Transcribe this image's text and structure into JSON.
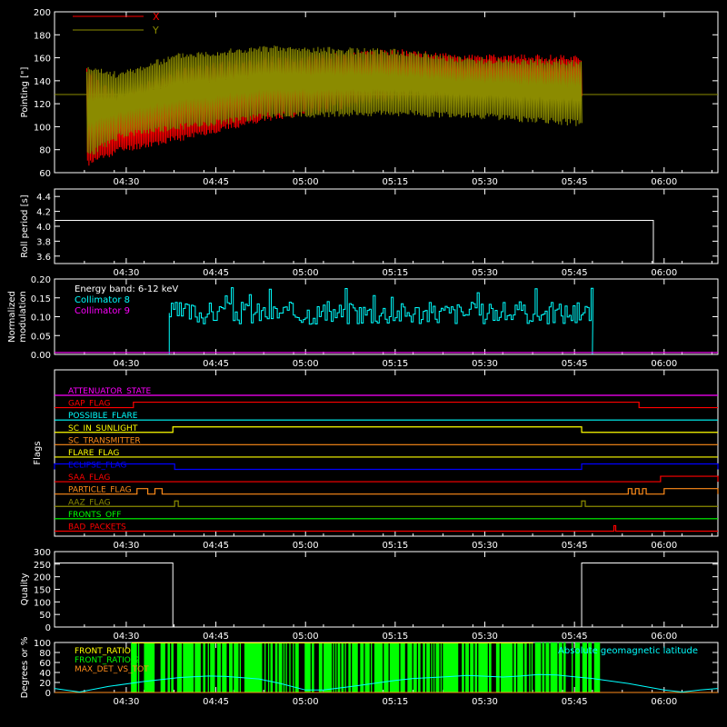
{
  "colors": {
    "background": "#000000",
    "axes": "#ffffff",
    "x_red": "#ff0000",
    "y_olive": "#8b8b00",
    "cyan": "#00ffff",
    "magenta": "#ff00ff",
    "green": "#00ff00",
    "yellow": "#ffff00",
    "orange": "#ff8c1a",
    "blue": "#0000ff"
  },
  "chart_data": [
    {
      "id": "pointing",
      "type": "line",
      "ylabel": "Pointing [\"]",
      "ylim": [
        60,
        200
      ],
      "yticks": [
        60,
        80,
        100,
        120,
        140,
        160,
        180,
        200
      ],
      "x_ticks": [
        "04:30",
        "04:45",
        "05:00",
        "05:15",
        "05:30",
        "05:45",
        "06:00"
      ],
      "xlim_min": [
        4.3,
        6.15
      ],
      "series": [
        {
          "name": "X",
          "color": "#ff0000",
          "envelope_x_min": [
            4.39,
            4.48,
            4.65,
            4.9,
            5.25,
            5.45,
            5.77
          ],
          "upper": [
            150,
            125,
            150,
            158,
            165,
            160,
            160
          ],
          "lower": [
            68,
            80,
            90,
            108,
            125,
            128,
            128
          ]
        },
        {
          "name": "Y",
          "color": "#8b8b00",
          "envelope_x_min": [
            4.39,
            4.48,
            4.65,
            4.9,
            5.25,
            5.45,
            5.77
          ],
          "upper": [
            150,
            145,
            162,
            168,
            165,
            158,
            155
          ],
          "lower": [
            75,
            92,
            100,
            110,
            112,
            110,
            103
          ]
        }
      ],
      "baseline": 128,
      "span_min": [
        4.39,
        5.77
      ],
      "legend": [
        "X",
        "Y"
      ]
    },
    {
      "id": "roll",
      "type": "line",
      "ylabel": "Roll period [s]",
      "ylim": [
        3.5,
        4.5
      ],
      "yticks": [
        3.6,
        3.8,
        4.0,
        4.2,
        4.4
      ],
      "x_ticks": [
        "04:30",
        "04:45",
        "05:00",
        "05:15",
        "05:30",
        "05:45",
        "06:00"
      ],
      "xlim_min": [
        4.3,
        6.15
      ],
      "value": 4.08,
      "span_min": [
        4.3,
        5.97
      ]
    },
    {
      "id": "modulation",
      "type": "line",
      "ylabel": "Normalized modulation",
      "ylim": [
        0,
        0.2
      ],
      "yticks": [
        0.0,
        0.05,
        0.1,
        0.15,
        0.2
      ],
      "x_ticks": [
        "04:30",
        "04:45",
        "05:00",
        "05:15",
        "05:30",
        "05:45",
        "06:00"
      ],
      "xlim_min": [
        4.3,
        6.15
      ],
      "annotation": "Energy band: 6-12 keV",
      "series": [
        {
          "name": "Collimator 8",
          "color": "#00ffff",
          "span_min": [
            4.62,
            5.8
          ],
          "mean": 0.11
        },
        {
          "name": "Collimator 9",
          "color": "#ff00ff",
          "value": 0.005
        }
      ]
    },
    {
      "id": "flags",
      "type": "line",
      "ylabel": "Flags",
      "x_ticks": [
        "04:30",
        "04:45",
        "05:00",
        "05:15",
        "05:30",
        "05:45",
        "06:00"
      ],
      "xlim_min": [
        4.3,
        6.15
      ],
      "series": [
        {
          "name": "ATTENUATOR_STATE",
          "color": "#ff00ff",
          "segments": []
        },
        {
          "name": "GAP_FLAG",
          "color": "#ff0000",
          "segments": [
            [
              4.52,
              5.93
            ]
          ]
        },
        {
          "name": "POSSIBLE_FLARE",
          "color": "#00ffff",
          "segments": []
        },
        {
          "name": "SC_IN_SUNLIGHT",
          "color": "#ffff00",
          "segments": [
            [
              4.63,
              5.77
            ]
          ]
        },
        {
          "name": "SC_TRANSMITTER",
          "color": "#ff8c1a",
          "segments": []
        },
        {
          "name": "FLARE_FLAG",
          "color": "#ffff00",
          "segments": []
        },
        {
          "name": "ECLIPSE_FLAG",
          "color": "#0000ff",
          "segments": [
            [
              4.3,
              4.635
            ],
            [
              5.77,
              6.15
            ]
          ]
        },
        {
          "name": "SAA_FLAG",
          "color": "#ff0000",
          "segments": [
            [
              5.99,
              6.15
            ]
          ]
        },
        {
          "name": "PARTICLE_FLAG",
          "color": "#ff8c1a",
          "segments": [
            [
              4.53,
              4.56
            ],
            [
              4.58,
              4.6
            ],
            [
              5.9,
              5.91
            ],
            [
              5.92,
              5.93
            ],
            [
              5.94,
              5.95
            ],
            [
              6.0,
              6.15
            ]
          ]
        },
        {
          "name": "AAZ_FLAG",
          "color": "#8b8b00",
          "segments": [
            [
              4.635,
              4.645
            ],
            [
              5.77,
              5.78
            ]
          ]
        },
        {
          "name": "FRONTS_OFF",
          "color": "#00ff00",
          "segments": []
        },
        {
          "name": "BAD_PACKETS",
          "color": "#ff0000",
          "segments": [
            [
              5.86,
              5.865
            ]
          ]
        }
      ]
    },
    {
      "id": "quality",
      "type": "line",
      "ylabel": "Quality",
      "ylim": [
        0,
        300
      ],
      "yticks": [
        0,
        50,
        100,
        150,
        200,
        250,
        300
      ],
      "x_ticks": [
        "04:30",
        "04:45",
        "05:00",
        "05:15",
        "05:30",
        "05:45",
        "06:00"
      ],
      "xlim_min": [
        4.3,
        6.15
      ],
      "value": 255,
      "segments": [
        [
          4.3,
          4.63
        ],
        [
          5.77,
          6.15
        ]
      ]
    },
    {
      "id": "geomag",
      "type": "area",
      "ylabel": "Degrees or %",
      "ylim": [
        0,
        100
      ],
      "yticks": [
        0,
        20,
        40,
        60,
        80,
        100
      ],
      "x_ticks": [
        "04:30",
        "04:45",
        "05:00",
        "05:15",
        "05:30",
        "05:45",
        "06:00"
      ],
      "xlim_min": [
        4.3,
        6.15
      ],
      "series": [
        {
          "name": "FRONT_RATIO",
          "color": "#ffff00",
          "span_min": [
            4.515,
            5.635
          ]
        },
        {
          "name": "FRONT_RATIO_2",
          "color": "#00ff00",
          "span_min": [
            4.515,
            5.82
          ],
          "value": 100
        },
        {
          "name": "MAX_DET_VS_TOT",
          "color": "#ff8c1a",
          "value": 0
        },
        {
          "name": "Absolute geomagnetic latitude",
          "color": "#00ffff",
          "x_min": [
            4.3,
            4.37,
            4.45,
            4.55,
            4.65,
            4.73,
            4.78,
            4.87,
            4.93,
            5.0,
            5.05,
            5.15,
            5.25,
            5.3,
            5.38,
            5.45,
            5.55,
            5.6,
            5.65,
            5.7,
            5.8,
            5.9,
            6.0,
            6.05,
            6.1,
            6.15
          ],
          "values": [
            8,
            1,
            12,
            22,
            30,
            33,
            32,
            27,
            18,
            5,
            5,
            14,
            24,
            28,
            31,
            34,
            31,
            33,
            36,
            35,
            28,
            18,
            5,
            1,
            5,
            8
          ]
        }
      ]
    }
  ]
}
